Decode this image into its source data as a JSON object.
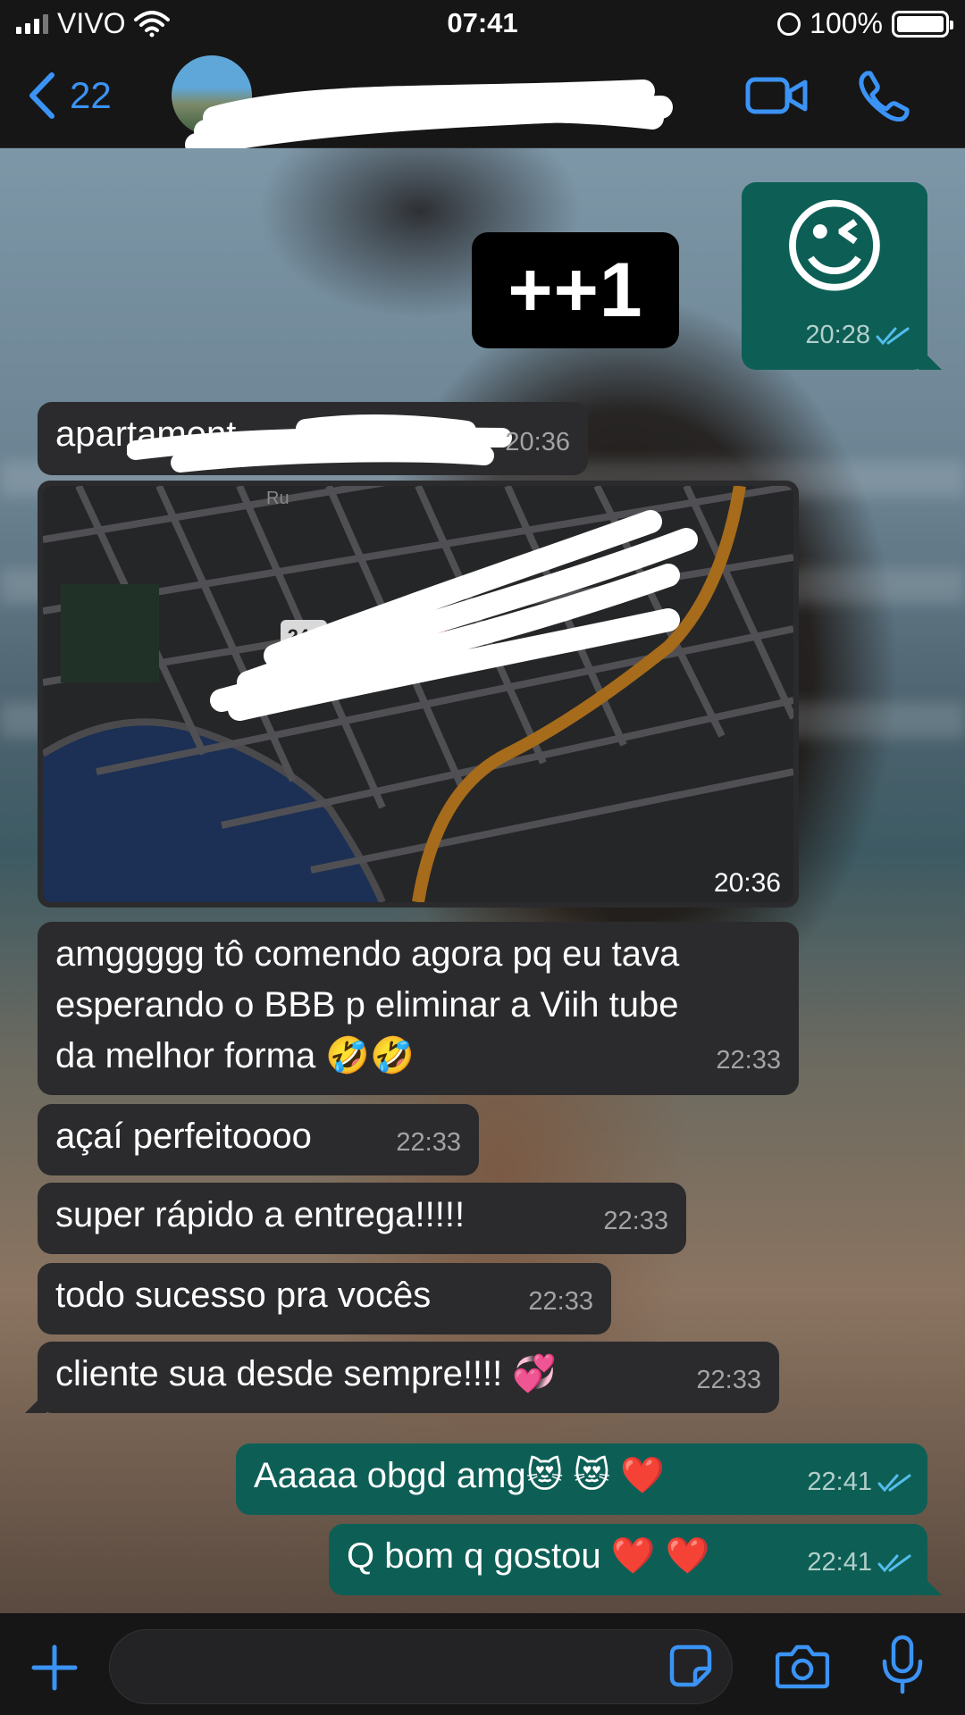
{
  "status_bar": {
    "carrier": "VIVO",
    "time": "07:41",
    "battery": "100%"
  },
  "nav": {
    "back_count": "22"
  },
  "sticker_text": "++1",
  "messages": [
    {
      "dir": "out",
      "text": "😉",
      "time": "20:28"
    },
    {
      "dir": "in",
      "text": "apartament",
      "time": "20:36"
    },
    {
      "dir": "in",
      "kind": "map",
      "road_label": "248",
      "street_label_1": "Ru",
      "street_label_2": "Ru",
      "time": "20:36"
    },
    {
      "dir": "in",
      "lines": [
        "amggggg tô comendo agora pq eu tava",
        "esperando o BBB p eliminar a Viih tube",
        "da melhor forma"
      ],
      "time": "22:33"
    },
    {
      "dir": "in",
      "text": "açaí perfeitoooo",
      "time": "22:33"
    },
    {
      "dir": "in",
      "text": "super rápido a entrega!!!!!",
      "time": "22:33"
    },
    {
      "dir": "in",
      "text": "todo sucesso pra vocês",
      "time": "22:33"
    },
    {
      "dir": "in",
      "text": "cliente sua desde sempre!!!!",
      "time": "22:33"
    },
    {
      "dir": "out",
      "text": "Aaaaa obgd amg",
      "time": "22:41"
    },
    {
      "dir": "out",
      "text": "Q bom q gostou",
      "time": "22:41"
    }
  ],
  "icons": {
    "back": "chevron-left-icon",
    "video": "video-camera-icon",
    "phone": "phone-icon",
    "plus": "plus-icon",
    "sticker": "sticker-icon",
    "camera": "camera-icon",
    "mic": "microphone-icon"
  },
  "colors": {
    "accent": "#3b93f5",
    "outgoing_bubble": "#0d5f56",
    "incoming_bubble": "#2b2b2d"
  }
}
